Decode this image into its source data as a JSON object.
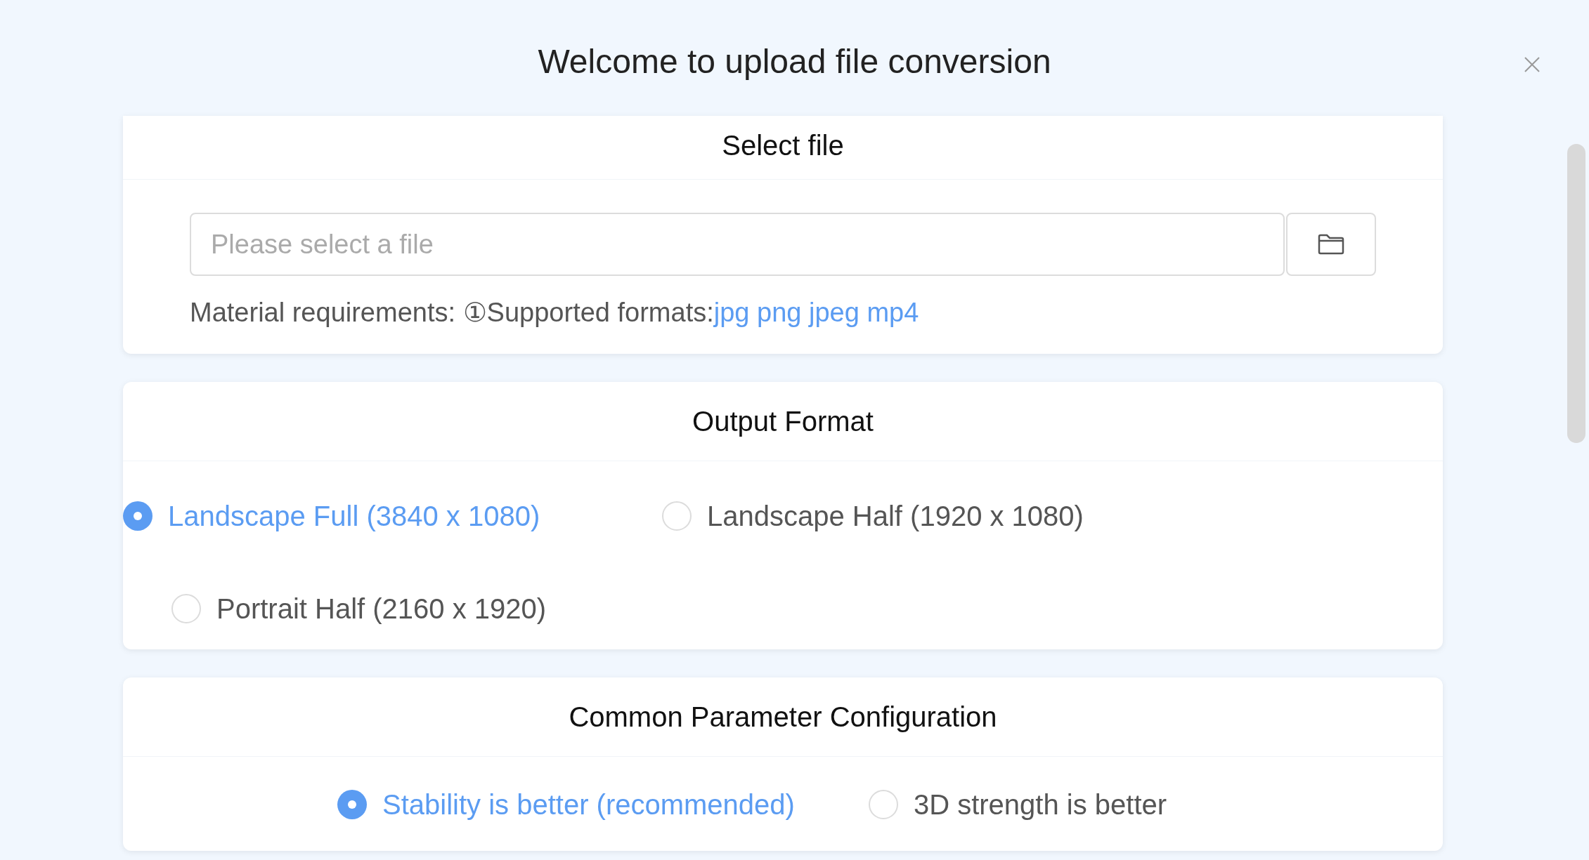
{
  "dialog": {
    "title": "Welcome to upload file conversion"
  },
  "sections": [
    {
      "kind": "file",
      "title": "Select file",
      "field": {
        "placeholder": "Please select a file"
      },
      "requirements": {
        "label": "Material requirements: ",
        "note_mark": "①",
        "note": "Supported formats:",
        "formats": "jpg png jpeg mp4"
      }
    },
    {
      "kind": "radio_grid",
      "title": "Output Format",
      "options": [
        {
          "label": "Landscape Full (3840 x 1080)",
          "selected": true
        },
        {
          "label": "Landscape Half (1920 x 1080)",
          "selected": false
        },
        {
          "label": "Portrait Half (2160 x 1920)",
          "selected": false
        }
      ]
    },
    {
      "kind": "radio_row",
      "title": "Common Parameter Configuration",
      "options": [
        {
          "label": "Stability is better (recommended)",
          "selected": true
        },
        {
          "label": "3D strength is better",
          "selected": false
        }
      ]
    }
  ]
}
